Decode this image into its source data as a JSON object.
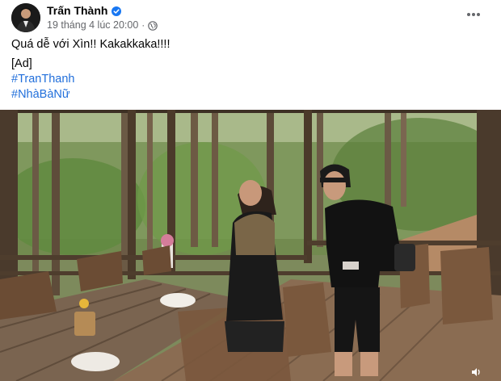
{
  "post": {
    "author_name": "Trấn Thành",
    "timestamp": "19 tháng 4 lúc 20:00",
    "separator": "·",
    "caption": "Quá dễ với Xìn!! Kakakkaka!!!!",
    "ad_tag": "[Ad]",
    "hashtags": [
      "#TranThanh",
      "#NhàBàNữ"
    ]
  },
  "icons": {
    "verified": "verified-badge-icon",
    "privacy": "globe-icon",
    "more": "more-options-icon",
    "video": "volume-icon"
  },
  "colors": {
    "hashtag": "#216fdb",
    "verified": "#1877f2",
    "secondary_text": "#65676b"
  }
}
